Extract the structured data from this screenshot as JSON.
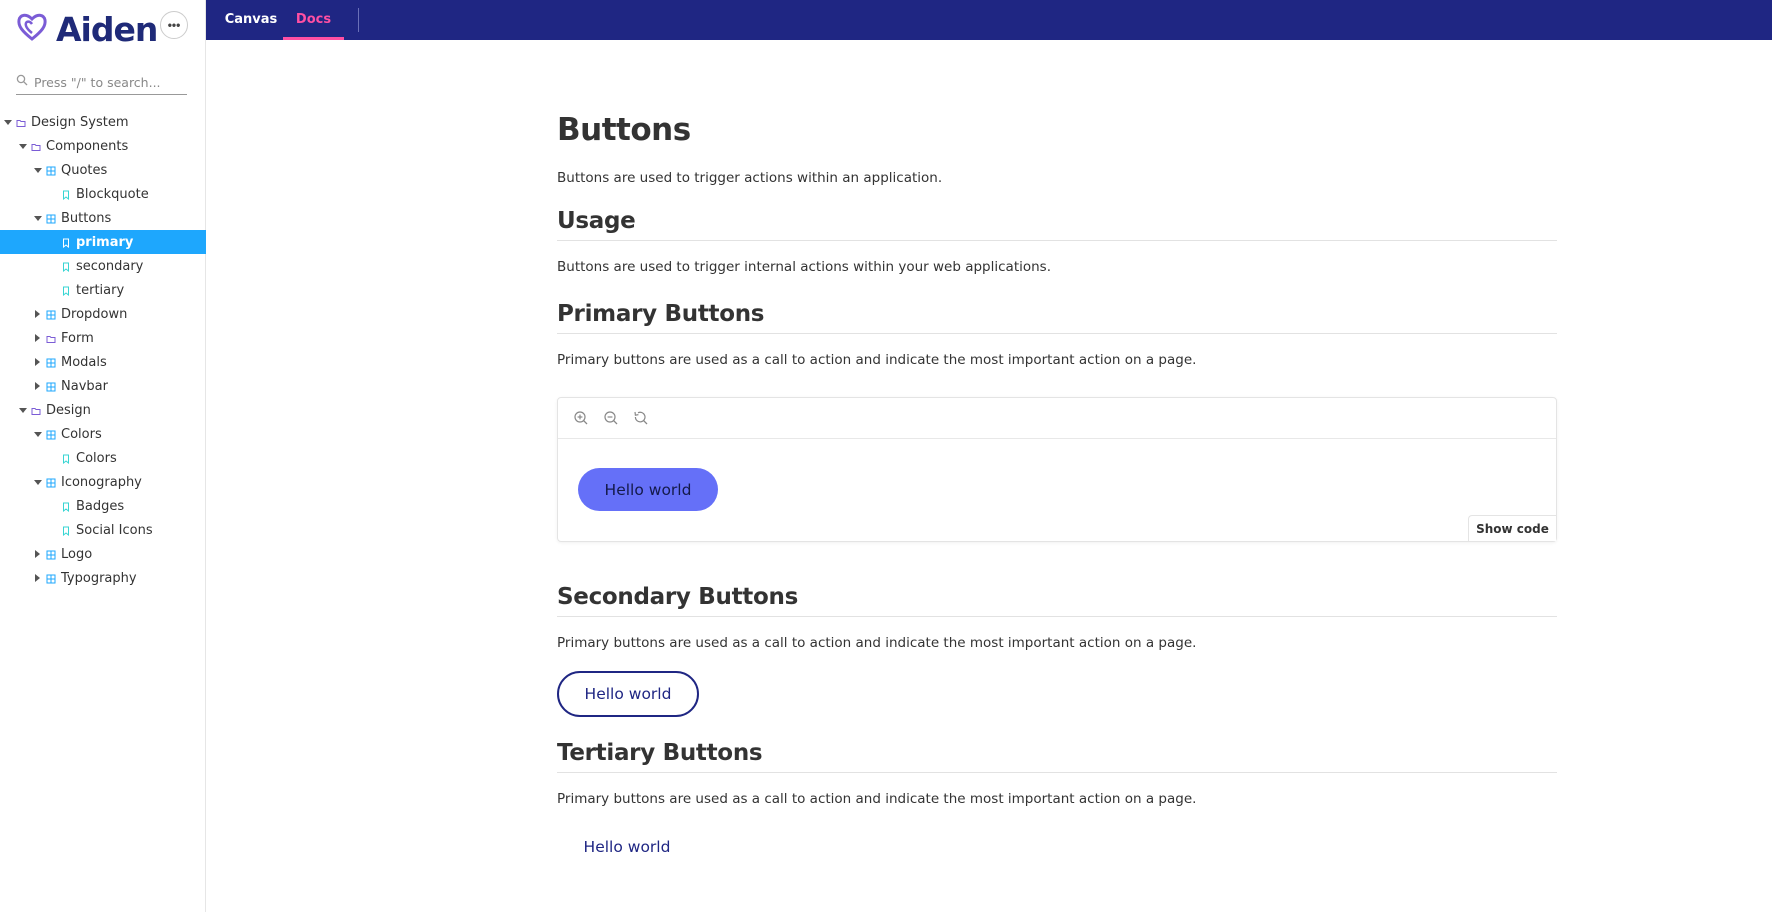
{
  "brand": {
    "name": "Aiden",
    "logo_icon": "heart-icon",
    "more_icon": "ellipsis-icon",
    "more_label": "•••"
  },
  "search": {
    "placeholder": "Press \"/\" to search...",
    "icon": "search-icon"
  },
  "tree": [
    {
      "label": "Design System",
      "icon": "folder-icon",
      "caret": "down",
      "level": 0
    },
    {
      "label": "Components",
      "icon": "folder-icon",
      "caret": "down",
      "level": 1
    },
    {
      "label": "Quotes",
      "icon": "component-icon",
      "caret": "down",
      "level": 2
    },
    {
      "label": "Blockquote",
      "icon": "bookmark-icon",
      "caret": "",
      "level": 3
    },
    {
      "label": "Buttons",
      "icon": "component-icon",
      "caret": "down",
      "level": 2
    },
    {
      "label": "primary",
      "icon": "bookmark-icon",
      "caret": "",
      "level": 3,
      "selected": true
    },
    {
      "label": "secondary",
      "icon": "bookmark-icon",
      "caret": "",
      "level": 3
    },
    {
      "label": "tertiary",
      "icon": "bookmark-icon",
      "caret": "",
      "level": 3
    },
    {
      "label": "Dropdown",
      "icon": "component-icon",
      "caret": "right",
      "level": 2
    },
    {
      "label": "Form",
      "icon": "folder-icon",
      "caret": "right",
      "level": 2
    },
    {
      "label": "Modals",
      "icon": "component-icon",
      "caret": "right",
      "level": 2
    },
    {
      "label": "Navbar",
      "icon": "component-icon",
      "caret": "right",
      "level": 2
    },
    {
      "label": "Design",
      "icon": "folder-icon",
      "caret": "down",
      "level": 1
    },
    {
      "label": "Colors",
      "icon": "component-icon",
      "caret": "down",
      "level": 2
    },
    {
      "label": "Colors",
      "icon": "bookmark-icon",
      "caret": "",
      "level": 3
    },
    {
      "label": "Iconography",
      "icon": "component-icon",
      "caret": "down",
      "level": 2
    },
    {
      "label": "Badges",
      "icon": "bookmark-icon",
      "caret": "",
      "level": 3
    },
    {
      "label": "Social Icons",
      "icon": "bookmark-icon",
      "caret": "",
      "level": 3
    },
    {
      "label": "Logo",
      "icon": "component-icon",
      "caret": "right",
      "level": 2
    },
    {
      "label": "Typography",
      "icon": "component-icon",
      "caret": "right",
      "level": 2
    }
  ],
  "tabs": [
    {
      "label": "Canvas",
      "active": false
    },
    {
      "label": "Docs",
      "active": true
    }
  ],
  "doc": {
    "title": "Buttons",
    "intro": "Buttons are used to trigger actions within an application.",
    "usage_heading": "Usage",
    "usage_text": "Buttons are used to trigger internal actions within your web applications.",
    "primary_heading": "Primary Buttons",
    "primary_text": "Primary buttons are used as a call to action and indicate the most important action on a page.",
    "primary_button": "Hello world",
    "show_code": "Show code",
    "zoom_icons": [
      "zoom-in-icon",
      "zoom-out-icon",
      "zoom-reset-icon"
    ],
    "secondary_heading": "Secondary Buttons",
    "secondary_text": "Primary buttons are used as a call to action and indicate the most important action on a page.",
    "secondary_button": "Hello world",
    "tertiary_heading": "Tertiary Buttons",
    "tertiary_text": "Primary buttons are used as a call to action and indicate the most important action on a page.",
    "tertiary_button": "Hello world"
  },
  "colors": {
    "topbar": "#1f2683",
    "active_tab": "#ff4fa3",
    "selected_item": "#1ea7fd",
    "primary_button": "#6570f8",
    "folder_icon": "#7b5cd6",
    "component_icon": "#1ea7fd",
    "bookmark_icon": "#37d5d3"
  }
}
